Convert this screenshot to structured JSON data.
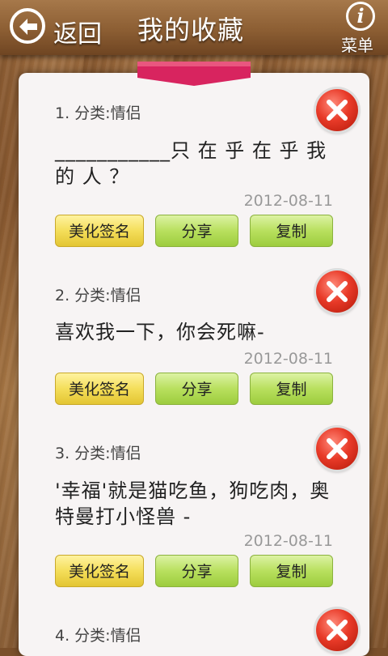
{
  "header": {
    "back_label": "返回",
    "title": "我的收藏",
    "menu_label": "菜单"
  },
  "items": [
    {
      "category": "1. 分类:情侣",
      "text": "___________只 在 乎 在 乎 我 的 人 ？",
      "date": "2012-08-11",
      "beautify": "美化签名",
      "share": "分享",
      "copy": "复制"
    },
    {
      "category": "2. 分类:情侣",
      "text": "喜欢我一下，你会死嘛-",
      "date": "2012-08-11",
      "beautify": "美化签名",
      "share": "分享",
      "copy": "复制"
    },
    {
      "category": "3. 分类:情侣",
      "text": "'幸福'就是猫吃鱼，狗吃肉，奥特曼打小怪兽 -",
      "date": "2012-08-11",
      "beautify": "美化签名",
      "share": "分享",
      "copy": "复制"
    },
    {
      "category": "4. 分类:情侣"
    }
  ],
  "colors": {
    "accent_ribbon": "#d8245f",
    "delete_red": "#e83a28",
    "button_yellow": "#f4de5a",
    "button_green": "#b8e05e"
  }
}
